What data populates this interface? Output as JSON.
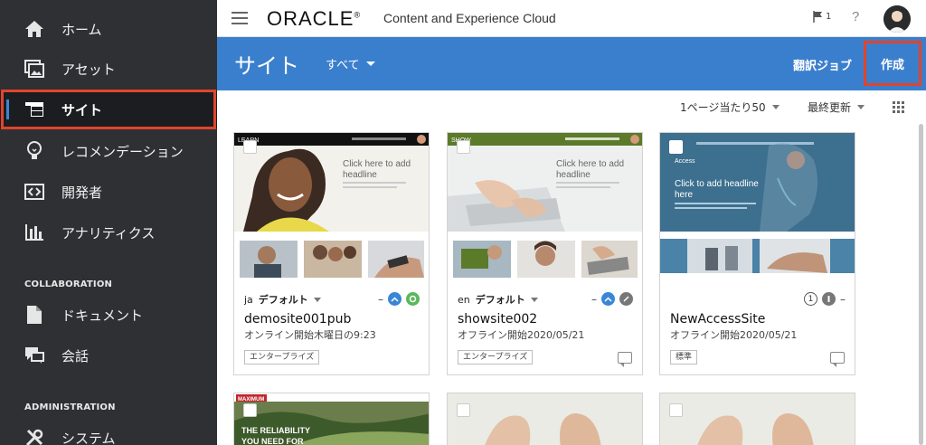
{
  "sidebar": {
    "items": [
      {
        "label": "ホーム",
        "icon": "home-icon"
      },
      {
        "label": "アセット",
        "icon": "assets-icon"
      },
      {
        "label": "サイト",
        "icon": "sites-icon"
      },
      {
        "label": "レコメンデーション",
        "icon": "lightbulb-icon"
      },
      {
        "label": "開発者",
        "icon": "developer-icon"
      },
      {
        "label": "アナリティクス",
        "icon": "analytics-icon"
      },
      {
        "label": "ドキュメント",
        "icon": "document-icon"
      },
      {
        "label": "会話",
        "icon": "conversation-icon"
      },
      {
        "label": "システム",
        "icon": "tools-icon"
      }
    ],
    "section_collaboration": "COLLABORATION",
    "section_administration": "ADMINISTRATION",
    "active_index": 2
  },
  "header": {
    "logo": "ORACLE",
    "logo_mark": "®",
    "product": "Content and Experience Cloud",
    "flag_count": "1",
    "help": "?"
  },
  "subbar": {
    "title": "サイト",
    "filter": "すべて",
    "translate_job": "翻訳ジョブ",
    "create": "作成"
  },
  "toolbar": {
    "per_page": "1ページ当たり50",
    "sort": "最終更新"
  },
  "cards": [
    {
      "name": "demosite001pub",
      "status": "オンライン開始木曜日の9:23",
      "lang_code": "ja",
      "lang_label": "デフォルト",
      "tag": "エンタープライズ",
      "template_label": "LEARN",
      "headline": "Click here to add headline",
      "theme": "#ffffff"
    },
    {
      "name": "showsite002",
      "status": "オフライン開始2020/05/21",
      "lang_code": "en",
      "lang_label": "デフォルト",
      "tag": "エンタープライズ",
      "template_label": "SHOW",
      "headline": "Click here to add headline",
      "theme": "#5b7a2a"
    },
    {
      "name": "NewAccessSite",
      "status": "オフライン開始2020/05/21",
      "tag": "標準",
      "count": "1",
      "template_label": "Access",
      "headline": "Click to add headline here",
      "theme": "#3d6f8f"
    }
  ],
  "lower_cards": [
    {
      "label": "MAXIMUM",
      "headline": "THE RELIABILITY YOU NEED FOR"
    },
    {
      "label": ""
    },
    {
      "label": ""
    }
  ],
  "colors": {
    "sidebar_bg": "#2f3034",
    "accent_blue": "#3a7fcd",
    "highlight_red": "#e0452b"
  }
}
